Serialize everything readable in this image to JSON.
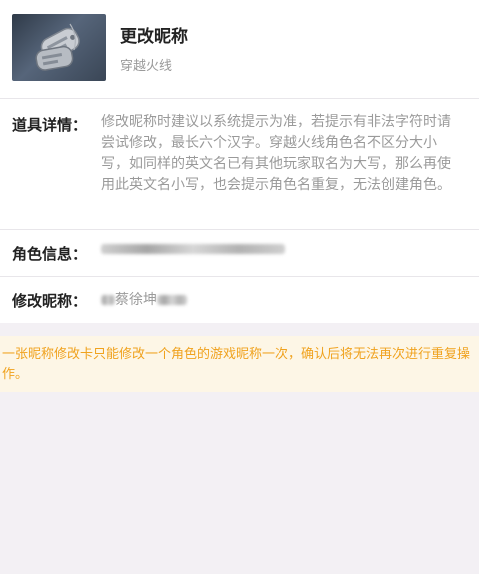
{
  "item": {
    "name": "更改昵称",
    "subtitle": "穿越火线",
    "icon": "dog-tag-icon"
  },
  "details": {
    "label": "道具详情：",
    "text": "修改昵称时建议以系统提示为准，若提示有非法字符时请尝试修改，最长六个汉字。穿越火线角色名不区分大小写，如同样的英文名已有其他玩家取名为大写，那么再使用此英文名小写，也会提示角色名重复，无法创建角色。"
  },
  "role_info": {
    "label": "角色信息："
  },
  "nickname": {
    "label": "修改昵称：",
    "value": "蔡徐坤"
  },
  "notice": {
    "text": "一张昵称修改卡只能修改一个角色的游戏昵称一次，确认后将无法再次进行重复操作。",
    "color": "#f0a21e",
    "background": "#fdf6e6"
  }
}
